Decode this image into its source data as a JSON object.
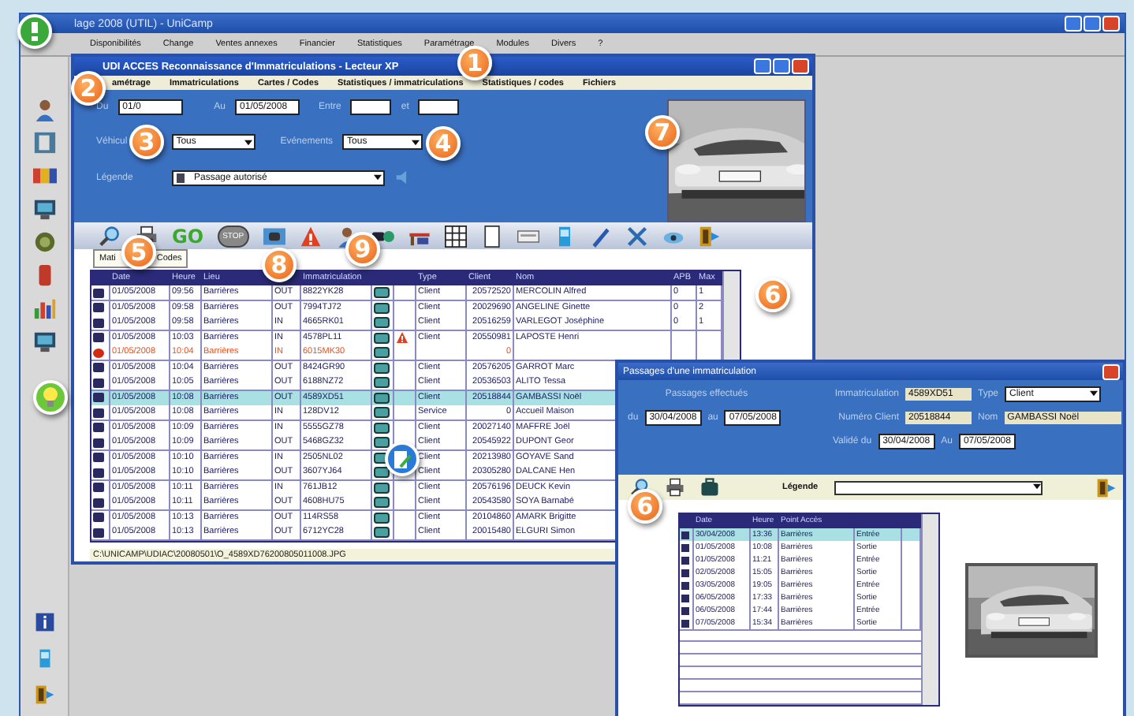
{
  "app": {
    "title": "lage 2008 (UTIL) - UniCamp",
    "menu": [
      "Disponibilités",
      "Change",
      "Ventes annexes",
      "Financier",
      "Statistiques",
      "Paramétrage",
      "Modules",
      "Divers",
      "?"
    ]
  },
  "sidebar": {
    "top": [
      {
        "kind": "person"
      },
      {
        "kind": "door"
      },
      {
        "kind": "colors"
      },
      {
        "kind": "monitor"
      },
      {
        "kind": "coins"
      },
      {
        "kind": "can"
      },
      {
        "kind": "chart"
      },
      {
        "kind": "screen"
      }
    ],
    "bottom": [
      {
        "kind": "info"
      },
      {
        "kind": "phone"
      },
      {
        "kind": "exit"
      }
    ]
  },
  "main_window": {
    "title": "UDI ACCES Reconnaissance d'Immatriculations - Lecteur XP",
    "menu": [
      "amétrage",
      "Immatriculations",
      "Cartes / Codes",
      "Statistiques / immatriculations",
      "Statistiques / codes",
      "Fichiers"
    ],
    "filters": {
      "from_label": "Du",
      "from": "01/0",
      "to_label": "Au",
      "to": "01/05/2008",
      "between_label": "Entre",
      "and_label": "et",
      "vehicle_label": "Véhicul",
      "vehicle": "Tous",
      "events_label": "Evénements",
      "events": "Tous",
      "legend_label": "Légende",
      "legend": "Passage autorisé"
    },
    "toolbar": [
      {
        "kind": "search"
      },
      {
        "kind": "print"
      },
      {
        "kind": "go",
        "label": "GO"
      },
      {
        "kind": "stop",
        "label": "STOP"
      },
      {
        "kind": "camera"
      },
      {
        "kind": "warning"
      },
      {
        "kind": "person"
      },
      {
        "kind": "card"
      },
      {
        "kind": "barrier"
      },
      {
        "kind": "grid"
      },
      {
        "kind": "document"
      },
      {
        "kind": "keypad"
      },
      {
        "kind": "phone"
      },
      {
        "kind": "pen"
      },
      {
        "kind": "tools"
      },
      {
        "kind": "eye"
      },
      {
        "kind": "exit"
      }
    ],
    "tab": {
      "label_start": "Mati",
      "label_end": "Codes"
    },
    "table": {
      "headers": [
        "Date",
        "Heure",
        "Lieu",
        "Immatriculation",
        "Type",
        "Client",
        "Nom",
        "APB",
        "Max"
      ],
      "rows": [
        {
          "date": "01/05/2008",
          "time": "09:56",
          "place": "Barrières",
          "direction": "OUT",
          "plate": "8822YK28",
          "type": "Client",
          "client": "20572520",
          "name": "MERCOLIN Alfred",
          "apb": "0",
          "max": "1",
          "alert": false,
          "warning": false,
          "selected": false
        },
        {
          "date": "01/05/2008",
          "time": "09:58",
          "place": "Barrières",
          "direction": "OUT",
          "plate": "7994TJ72",
          "type": "Client",
          "client": "20029690",
          "name": "ANGELINE Ginette",
          "apb": "0",
          "max": "2",
          "alert": false,
          "warning": false,
          "selected": false
        },
        {
          "date": "01/05/2008",
          "time": "09:58",
          "place": "Barrières",
          "direction": "IN",
          "plate": "4665RK01",
          "type": "Client",
          "client": "20516259",
          "name": "VARLEGOT Joséphine",
          "apb": "0",
          "max": "1",
          "alert": false,
          "warning": false,
          "selected": false
        },
        {
          "date": "01/05/2008",
          "time": "10:03",
          "place": "Barrières",
          "direction": "IN",
          "plate": "4578PL11",
          "type": "Client",
          "client": "20550981",
          "name": "LAPOSTE Henri",
          "alert": false,
          "warning": true,
          "selected": false
        },
        {
          "date": "01/05/2008",
          "time": "10:04",
          "place": "Barrières",
          "direction": "IN",
          "plate": "6015MK30",
          "client": "0",
          "alert": true,
          "warning": false,
          "selected": false
        },
        {
          "date": "01/05/2008",
          "time": "10:04",
          "place": "Barrières",
          "direction": "OUT",
          "plate": "8424GR90",
          "type": "Client",
          "client": "20576205",
          "name": "GARROT Marc",
          "alert": false,
          "warning": false,
          "selected": false
        },
        {
          "date": "01/05/2008",
          "time": "10:05",
          "place": "Barrières",
          "direction": "OUT",
          "plate": "6188NZ72",
          "type": "Client",
          "client": "20536503",
          "name": "ALITO Tessa",
          "alert": false,
          "warning": false,
          "selected": false
        },
        {
          "date": "01/05/2008",
          "time": "10:08",
          "place": "Barrières",
          "direction": "OUT",
          "plate": "4589XD51",
          "type": "Client",
          "client": "20518844",
          "name": "GAMBASSI Noël",
          "alert": false,
          "warning": false,
          "selected": true
        },
        {
          "date": "01/05/2008",
          "time": "10:08",
          "place": "Barrières",
          "direction": "IN",
          "plate": "128DV12",
          "type": "Service",
          "client": "0",
          "name": "Accueil Maison",
          "alert": false,
          "warning": false,
          "selected": false
        },
        {
          "date": "01/05/2008",
          "time": "10:09",
          "place": "Barrières",
          "direction": "IN",
          "plate": "5555GZ78",
          "type": "Client",
          "client": "20027140",
          "name": "MAFFRE Joël",
          "alert": false,
          "warning": false,
          "selected": false
        },
        {
          "date": "01/05/2008",
          "time": "10:09",
          "place": "Barrières",
          "direction": "OUT",
          "plate": "5468GZ32",
          "type": "Client",
          "client": "20545922",
          "name": "DUPONT Geor",
          "alert": false,
          "warning": false,
          "selected": false
        },
        {
          "date": "01/05/2008",
          "time": "10:10",
          "place": "Barrières",
          "direction": "IN",
          "plate": "2505NL02",
          "type": "Client",
          "client": "20213980",
          "name": "GOYAVE Sand",
          "alert": false,
          "warning": false,
          "selected": false
        },
        {
          "date": "01/05/2008",
          "time": "10:10",
          "place": "Barrières",
          "direction": "OUT",
          "plate": "3607YJ64",
          "type": "Client",
          "client": "20305280",
          "name": "DALCANE Hen",
          "alert": false,
          "warning": false,
          "selected": false
        },
        {
          "date": "01/05/2008",
          "time": "10:11",
          "place": "Barrières",
          "direction": "IN",
          "plate": "761JB12",
          "type": "Client",
          "client": "20576196",
          "name": "DEUCK Kevin",
          "alert": false,
          "warning": false,
          "selected": false
        },
        {
          "date": "01/05/2008",
          "time": "10:11",
          "place": "Barrières",
          "direction": "OUT",
          "plate": "4608HU75",
          "type": "Client",
          "client": "20543580",
          "name": "SOYA Barnabé",
          "alert": false,
          "warning": false,
          "selected": false
        },
        {
          "date": "01/05/2008",
          "time": "10:13",
          "place": "Barrières",
          "direction": "OUT",
          "plate": "114RS58",
          "type": "Client",
          "client": "20104860",
          "name": "AMARK Brigitte",
          "alert": false,
          "warning": false,
          "selected": false
        },
        {
          "date": "01/05/2008",
          "time": "10:13",
          "place": "Barrières",
          "direction": "OUT",
          "plate": "6712YC28",
          "type": "Client",
          "client": "20015480",
          "name": "ELGURI Simon",
          "alert": false,
          "warning": false,
          "selected": false
        }
      ]
    },
    "path": "C:\\UNICAMP\\UDIAC\\20080501\\O_4589XD76200805011008.JPG"
  },
  "popup": {
    "title": "Passages d'une immatriculation",
    "passages_label": "Passages effectués",
    "from_label": "du",
    "from": "30/04/2008",
    "to_label": "au",
    "to": "07/05/2008",
    "plate_label": "Immatriculation",
    "plate": "4589XD51",
    "type_label": "Type",
    "type": "Client",
    "client_label": "Numéro Client",
    "client": "20518844",
    "name_label": "Nom",
    "name": "GAMBASSI Noël",
    "valid_label": "Validé du",
    "valid_from": "30/04/2008",
    "valid_to_label": "Au",
    "valid_to": "07/05/2008",
    "legend_label": "Légende",
    "table": {
      "headers": [
        "Date",
        "Heure",
        "Point Accès"
      ],
      "rows": [
        {
          "date": "30/04/2008",
          "time": "13:36",
          "place": "Barrières",
          "direction": "Entrée",
          "selected": true
        },
        {
          "date": "01/05/2008",
          "time": "10:08",
          "place": "Barrières",
          "direction": "Sortie",
          "selected": false
        },
        {
          "date": "01/05/2008",
          "time": "11:21",
          "place": "Barrières",
          "direction": "Entrée",
          "selected": false
        },
        {
          "date": "02/05/2008",
          "time": "15:05",
          "place": "Barrières",
          "direction": "Sortie",
          "selected": false
        },
        {
          "date": "03/05/2008",
          "time": "19:05",
          "place": "Barrières",
          "direction": "Entrée",
          "selected": false
        },
        {
          "date": "06/05/2008",
          "time": "17:33",
          "place": "Barrières",
          "direction": "Sortie",
          "selected": false
        },
        {
          "date": "06/05/2008",
          "time": "17:44",
          "place": "Barrières",
          "direction": "Entrée",
          "selected": false
        },
        {
          "date": "07/05/2008",
          "time": "15:34",
          "place": "Barrières",
          "direction": "Sortie",
          "selected": false
        }
      ]
    }
  },
  "callouts": [
    {
      "kind": "info"
    },
    {
      "kind": "number",
      "label": "1"
    },
    {
      "kind": "number",
      "label": "2"
    },
    {
      "kind": "number",
      "label": "3"
    },
    {
      "kind": "number",
      "label": "4"
    },
    {
      "kind": "number",
      "label": "7"
    },
    {
      "kind": "number",
      "label": "5"
    },
    {
      "kind": "number",
      "label": "8"
    },
    {
      "kind": "number",
      "label": "9"
    },
    {
      "kind": "number",
      "label": "6"
    },
    {
      "kind": "tip"
    },
    {
      "kind": "edit"
    },
    {
      "kind": "number",
      "label": "6"
    }
  ]
}
